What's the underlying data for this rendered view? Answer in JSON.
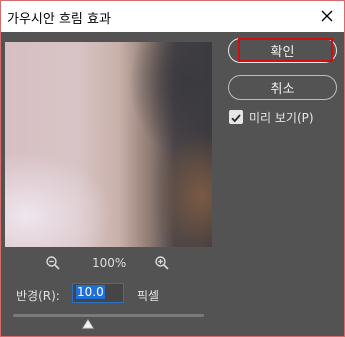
{
  "window": {
    "title": "가우시안 흐림 효과"
  },
  "preview": {
    "zoom_level": "100%"
  },
  "radius": {
    "label": "반경(R):",
    "value": "10.0",
    "unit": "픽셀"
  },
  "buttons": {
    "ok": "확인",
    "cancel": "취소"
  },
  "preview_toggle": {
    "label": "미리 보기(P)",
    "checked": true
  },
  "colors": {
    "dialog_bg": "#535353",
    "titlebar_bg": "#ffffff",
    "highlight_red": "#d01010",
    "input_focus": "#2d6fc0"
  },
  "icons": {
    "close": "close-icon",
    "zoom_out": "zoom-out-icon",
    "zoom_in": "zoom-in-icon",
    "checkbox": "check-icon",
    "slider_thumb": "slider-thumb-icon"
  }
}
